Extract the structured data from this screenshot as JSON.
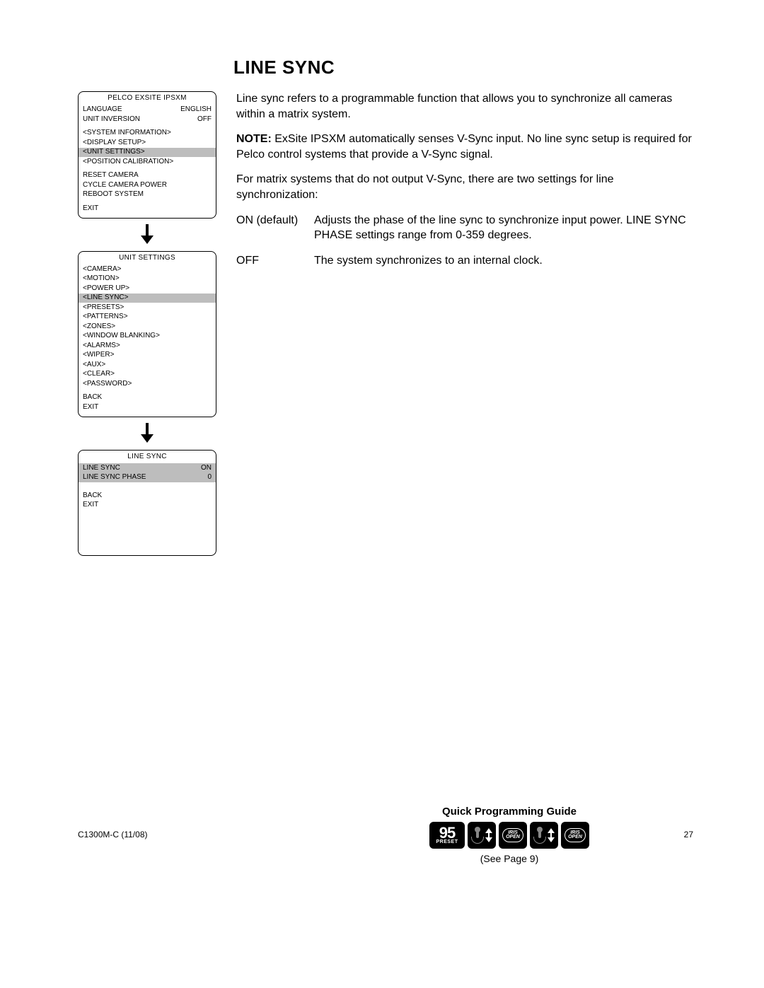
{
  "page_title": "Line Sync",
  "menu1": {
    "title": "PELCO EXSITE IPSXM",
    "rows": [
      {
        "label": "LANGUAGE",
        "value": "ENGLISH"
      },
      {
        "label": "UNIT INVERSION",
        "value": "OFF"
      }
    ],
    "submenus": [
      {
        "label": "<SYSTEM INFORMATION>",
        "hl": false
      },
      {
        "label": "<DISPLAY SETUP>",
        "hl": false
      },
      {
        "label": "<UNIT SETTINGS>",
        "hl": true
      },
      {
        "label": "<POSITION CALIBRATION>",
        "hl": false
      }
    ],
    "actions": [
      "RESET CAMERA",
      "CYCLE CAMERA POWER",
      "REBOOT SYSTEM"
    ],
    "exit": "EXIT"
  },
  "menu2": {
    "title": "UNIT SETTINGS",
    "items": [
      {
        "label": "<CAMERA>",
        "hl": false
      },
      {
        "label": "<MOTION>",
        "hl": false
      },
      {
        "label": "<POWER UP>",
        "hl": false
      },
      {
        "label": "<LINE SYNC>",
        "hl": true
      },
      {
        "label": "<PRESETS>",
        "hl": false
      },
      {
        "label": "<PATTERNS>",
        "hl": false
      },
      {
        "label": "<ZONES>",
        "hl": false
      },
      {
        "label": "<WINDOW BLANKING>",
        "hl": false
      },
      {
        "label": "<ALARMS>",
        "hl": false
      },
      {
        "label": "<WIPER>",
        "hl": false
      },
      {
        "label": "<AUX>",
        "hl": false
      },
      {
        "label": "<CLEAR>",
        "hl": false
      },
      {
        "label": "<PASSWORD>",
        "hl": false
      }
    ],
    "back": "BACK",
    "exit": "EXIT"
  },
  "menu3": {
    "title": "LINE SYNC",
    "rows": [
      {
        "label": "LINE SYNC",
        "value": "ON",
        "hl": true,
        "indent": false
      },
      {
        "label": "LINE SYNC PHASE",
        "value": "0",
        "hl": true,
        "indent": true
      }
    ],
    "back": "BACK",
    "exit": "EXIT"
  },
  "body": {
    "p1": "Line sync refers to a programmable function that allows you to synchronize all cameras within a matrix system.",
    "note_label": "NOTE:",
    "note_text": "ExSite IPSXM automatically senses V-Sync input. No line sync setup is required for Pelco control systems that provide a V-Sync signal.",
    "p3": "For matrix systems that do not output V-Sync, there are two settings for line synchronization:",
    "defs": [
      {
        "label": "ON (default)",
        "desc": "Adjusts the phase of the line sync to synchronize input power. LINE SYNC PHASE settings range from 0-359 degrees."
      },
      {
        "label": "OFF",
        "desc": "The system synchronizes to an internal clock."
      }
    ]
  },
  "qpg": {
    "title": "Quick Programming Guide",
    "preset_num": "95",
    "preset_lbl": "PRESET",
    "iris": "IRIS OPEN",
    "see": "(See Page 9)"
  },
  "footer": {
    "left": "C1300M-C (11/08)",
    "right": "27"
  }
}
